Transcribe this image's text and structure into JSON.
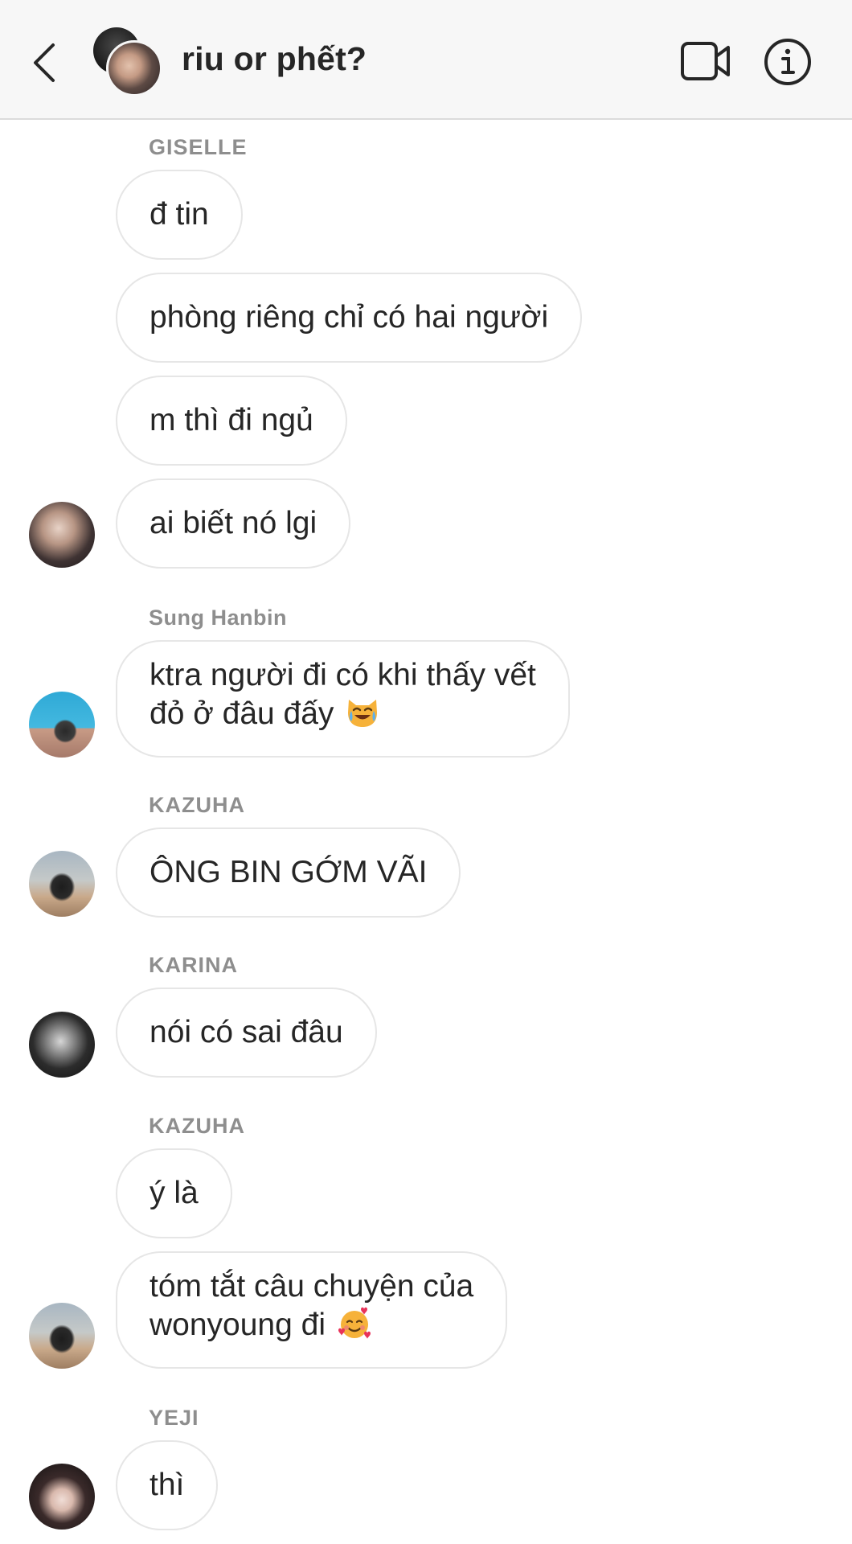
{
  "header": {
    "title": "riu or phết?",
    "back_icon": "chevron-left-icon",
    "video_icon": "video-camera-icon",
    "info_icon": "info-icon"
  },
  "messages": [
    {
      "sender": "GISELLE",
      "text": "đ tin"
    },
    {
      "sender": "",
      "text": "phòng riêng chỉ có hai người"
    },
    {
      "sender": "",
      "text": "m thì đi ngủ"
    },
    {
      "sender": "",
      "text": "ai biết nó lgi"
    },
    {
      "sender": "Sung Hanbin",
      "line1": "ktra người đi có khi thấy vết",
      "line2": "đỏ ở đâu đấy",
      "emoji": "cat-tears-of-joy-emoji"
    },
    {
      "sender": "KAZUHA",
      "text": "ÔNG BIN GỚM VÃI"
    },
    {
      "sender": "KARINA",
      "text": "nói có sai đâu"
    },
    {
      "sender": "KAZUHA",
      "text": "ý là"
    },
    {
      "sender": "",
      "line1": "tóm tắt câu chuyện của",
      "line2": "wonyoung đi",
      "emoji": "smiling-face-with-hearts-emoji"
    },
    {
      "sender": "YEJI",
      "text": "thì"
    }
  ],
  "colors": {
    "header_bg": "#f7f7f7",
    "bubble_border": "#e6e6e6",
    "text": "#262626",
    "sender": "#8e8e8e"
  }
}
